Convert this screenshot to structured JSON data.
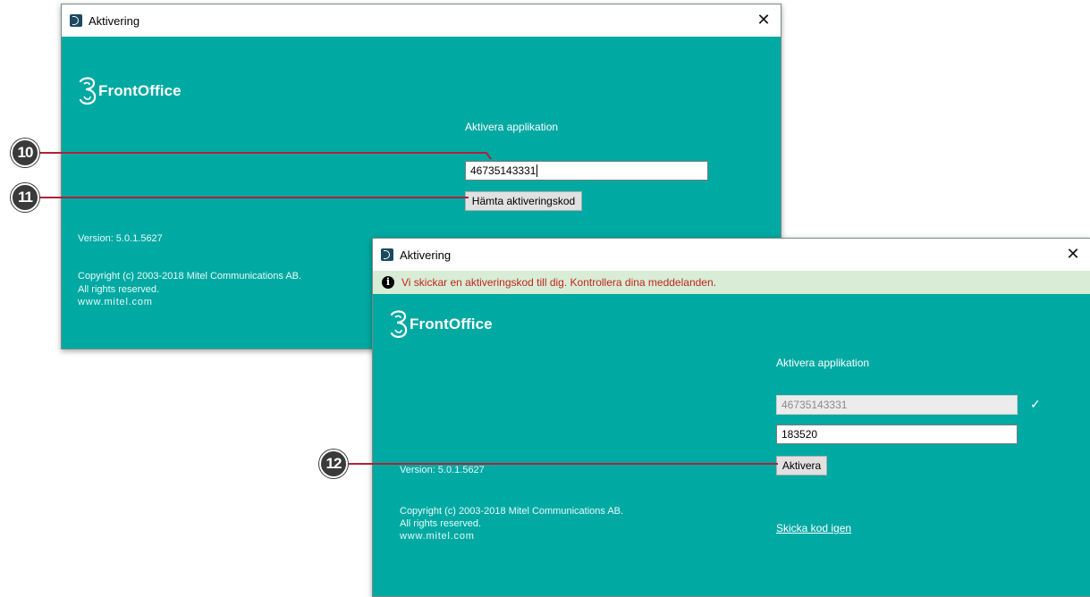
{
  "window1": {
    "title": "Aktivering",
    "close_glyph": "✕",
    "logo_text": "FrontOffice",
    "heading": "Aktivera applikation",
    "phone_value": "46735143331",
    "fetch_button": "Hämta aktiveringskod",
    "version": "Version: 5.0.1.5627",
    "copyright": "Copyright (c) 2003-2018 Mitel Communications AB.",
    "rights": "All rights reserved.",
    "website": "www.mitel.com"
  },
  "window2": {
    "title": "Aktivering",
    "close_glyph": "✕",
    "info_message": "Vi skickar en aktiveringskod till dig. Kontrollera dina meddelanden.",
    "logo_text": "FrontOffice",
    "heading": "Aktivera applikation",
    "phone_value": "46735143331",
    "check_glyph": "✓",
    "code_value": "183520",
    "activate_button": "Aktivera",
    "version": "Version: 5.0.1.5627",
    "copyright": "Copyright (c) 2003-2018 Mitel Communications AB.",
    "rights": "All rights reserved.",
    "website": "www.mitel.com",
    "resend_link": "Skicka kod igen"
  },
  "callouts": [
    "10",
    "11",
    "12"
  ],
  "colors": {
    "teal": "#00a9a2",
    "callout_line": "#b0203a",
    "info_bg": "#d8ecd6",
    "info_text": "#c0261c"
  },
  "icons": {
    "app": "three-logo-icon",
    "close": "close-icon",
    "info": "info-icon",
    "check": "checkmark-icon"
  }
}
